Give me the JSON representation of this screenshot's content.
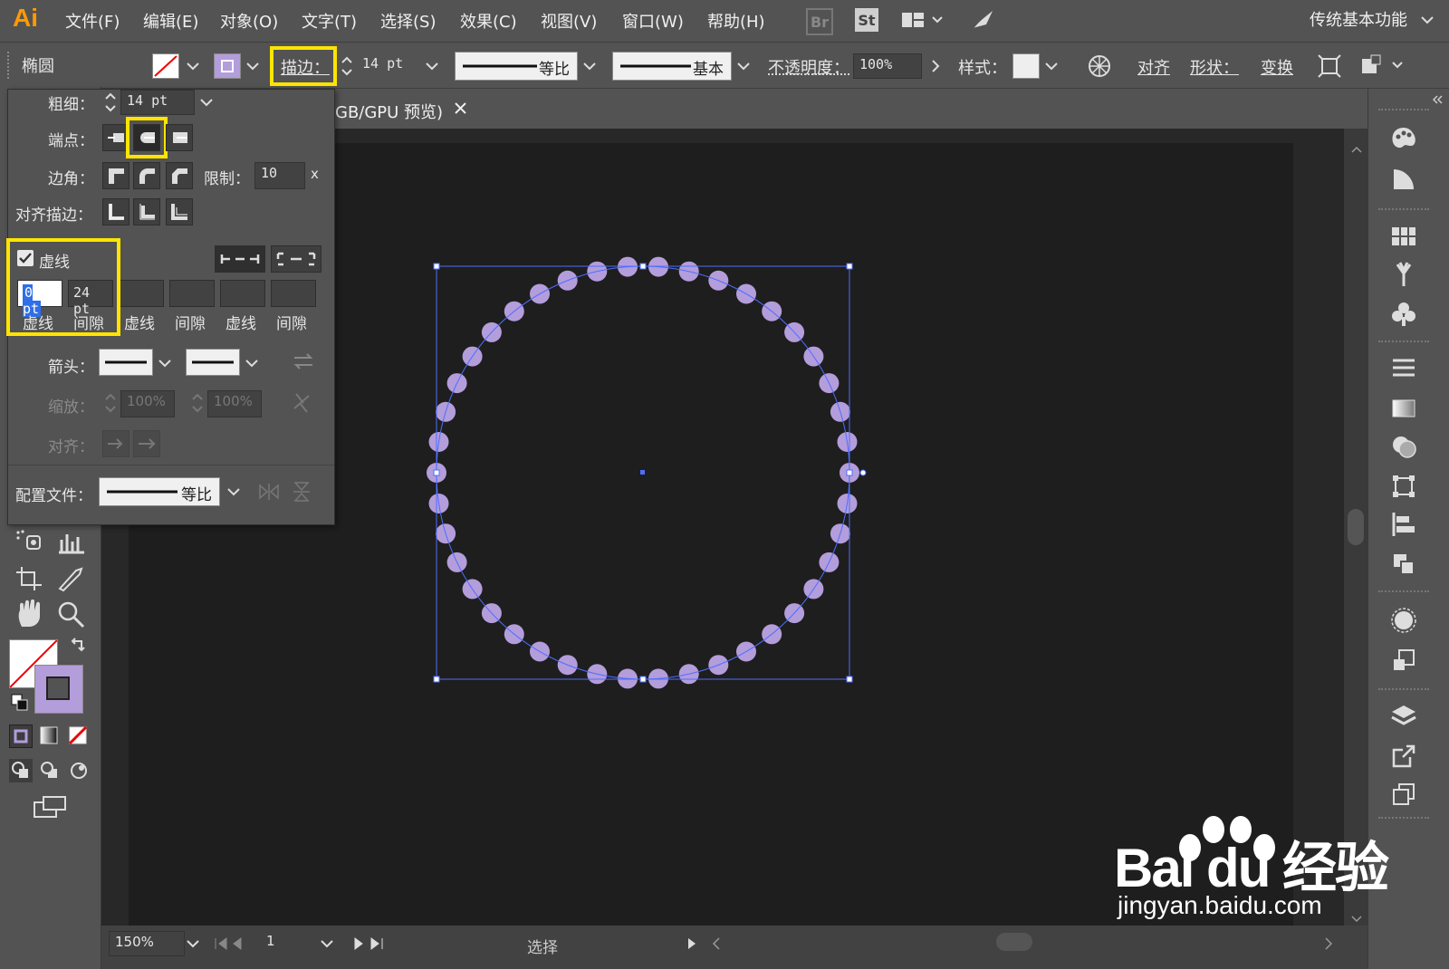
{
  "app": {
    "logo": "Ai",
    "menu": [
      "文件(F)",
      "编辑(E)",
      "对象(O)",
      "文字(T)",
      "选择(S)",
      "效果(C)",
      "视图(V)",
      "窗口(W)",
      "帮助(H)"
    ],
    "bridge_icon": "Br",
    "stock_icon": "St",
    "workspace": "传统基本功能"
  },
  "control_bar": {
    "object_type": "椭圆",
    "stroke_label": "描边：",
    "stroke_weight": "14 pt",
    "profile_label": "等比",
    "brush_label": "基本",
    "opacity_label": "不透明度：",
    "opacity_value": "100%",
    "style_label": "样式：",
    "align_label": "对齐",
    "shape_label": "形状：",
    "transform_label": "变换"
  },
  "stroke_panel": {
    "weight_label": "粗细：",
    "weight_value": "14 pt",
    "cap_label": "端点：",
    "corner_label": "边角：",
    "limit_label": "限制：",
    "limit_value": "10",
    "limit_unit": "x",
    "align_stroke_label": "对齐描边：",
    "dashed_label": "虚线",
    "dashed_checked": true,
    "dash_values": [
      "0 pt",
      "24 pt",
      "",
      "",
      "",
      ""
    ],
    "dash_labels": [
      "虚线",
      "间隙",
      "虚线",
      "间隙",
      "虚线",
      "间隙"
    ],
    "arrow_label": "箭头：",
    "scale_label": "缩放：",
    "scale_values": [
      "100%",
      "100%"
    ],
    "align_label": "对齐：",
    "profile_label": "配置文件：",
    "profile_value": "等比"
  },
  "document_tab": {
    "title": "GB/GPU 预览)"
  },
  "status_bar": {
    "zoom": "150%",
    "page": "1",
    "tool": "选择"
  },
  "watermark": {
    "brand": "Bai du 经验",
    "url": "jingyan.baidu.com"
  },
  "colors": {
    "ui_bg": "#535353",
    "artboard": "#1e1e1e",
    "dot_fill": "#b39ddb",
    "selection": "#4d6eff",
    "highlight": "#ffe400"
  },
  "artwork": {
    "dot_count": 42
  }
}
